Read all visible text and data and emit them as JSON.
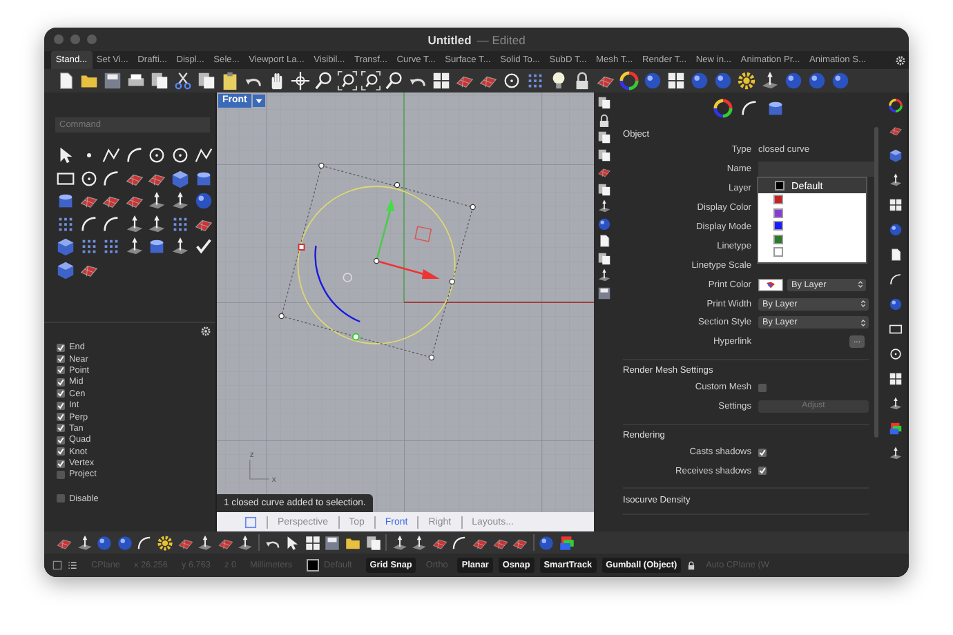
{
  "window": {
    "title": "Untitled",
    "note": "— Edited"
  },
  "toolbar_tabs": [
    {
      "label": "Stand...",
      "selected": true
    },
    {
      "label": "Set Vi...",
      "selected": false
    },
    {
      "label": "Drafti...",
      "selected": false
    },
    {
      "label": "Displ...",
      "selected": false
    },
    {
      "label": "Sele...",
      "selected": false
    },
    {
      "label": "Viewport La...",
      "selected": false
    },
    {
      "label": "Visibil...",
      "selected": false
    },
    {
      "label": "Transf...",
      "selected": false
    },
    {
      "label": "Curve T...",
      "selected": false
    },
    {
      "label": "Surface T...",
      "selected": false
    },
    {
      "label": "Solid To...",
      "selected": false
    },
    {
      "label": "SubD T...",
      "selected": false
    },
    {
      "label": "Mesh T...",
      "selected": false
    },
    {
      "label": "Render T...",
      "selected": false
    },
    {
      "label": "New in...",
      "selected": false
    },
    {
      "label": "Animation Pr...",
      "selected": false
    },
    {
      "label": "Animation S...",
      "selected": false
    }
  ],
  "command": {
    "placeholder": "Command"
  },
  "osnaps": [
    {
      "label": "End",
      "checked": true
    },
    {
      "label": "Near",
      "checked": true
    },
    {
      "label": "Point",
      "checked": true
    },
    {
      "label": "Mid",
      "checked": true
    },
    {
      "label": "Cen",
      "checked": true
    },
    {
      "label": "Int",
      "checked": true
    },
    {
      "label": "Perp",
      "checked": true
    },
    {
      "label": "Tan",
      "checked": true
    },
    {
      "label": "Quad",
      "checked": true
    },
    {
      "label": "Knot",
      "checked": true
    },
    {
      "label": "Vertex",
      "checked": true
    },
    {
      "label": "Project",
      "checked": false
    }
  ],
  "osnap_disable": {
    "label": "Disable",
    "checked": false
  },
  "viewport": {
    "name": "Front",
    "message": "1 closed curve added to selection.",
    "axis_labels": [
      "z",
      "x"
    ]
  },
  "viewport_tabs": [
    {
      "label": "Perspective",
      "selected": false
    },
    {
      "label": "Top",
      "selected": false
    },
    {
      "label": "Front",
      "selected": true
    },
    {
      "label": "Right",
      "selected": false
    },
    {
      "label": "Layouts...",
      "selected": false
    }
  ],
  "properties": {
    "sections": [
      {
        "title": "Object",
        "rows": [
          {
            "kind": "text",
            "label": "Type",
            "value": "closed curve"
          },
          {
            "kind": "field",
            "label": "Name"
          },
          {
            "kind": "covered",
            "label": "Layer"
          },
          {
            "kind": "covered",
            "label": "Display Color"
          },
          {
            "kind": "covered",
            "label": "Display Mode"
          },
          {
            "kind": "covered",
            "label": "Linetype"
          },
          {
            "kind": "covered",
            "label": "Linetype Scale"
          },
          {
            "kind": "color_select",
            "label": "Print Color",
            "value": "By Layer"
          },
          {
            "kind": "select",
            "label": "Print Width",
            "value": "By Layer"
          },
          {
            "kind": "select",
            "label": "Section Style",
            "value": "By Layer"
          },
          {
            "kind": "button",
            "label": "Hyperlink",
            "value": "...",
            "disabled": false
          }
        ]
      },
      {
        "title": "Render Mesh Settings",
        "rows": [
          {
            "kind": "checkbox",
            "label": "Custom Mesh",
            "checked": false
          },
          {
            "kind": "button",
            "label": "Settings",
            "value": "Adjust",
            "disabled": true
          }
        ]
      },
      {
        "title": "Rendering",
        "rows": [
          {
            "kind": "checkbox",
            "label": "Casts shadows",
            "checked": true
          },
          {
            "kind": "checkbox",
            "label": "Receives shadows",
            "checked": true
          }
        ]
      },
      {
        "title": "Isocurve Density"
      }
    ],
    "layer_menu": [
      {
        "label": "Default",
        "color": "#000000",
        "selected": true
      },
      {
        "color": "#cc2020",
        "selected": false
      },
      {
        "color": "#8a3ad8",
        "selected": false
      },
      {
        "color": "#1a1aff",
        "selected": false
      },
      {
        "color": "#2a7a2a",
        "selected": false
      },
      {
        "color": "#ffffff",
        "selected": false
      }
    ]
  },
  "status_bar": {
    "cplane": "CPlane",
    "x": "x 26.256",
    "y": "y 6.763",
    "z": "z 0",
    "units": "Millimeters",
    "layer": "Default",
    "toggles": [
      {
        "label": "Grid Snap",
        "on": true
      },
      {
        "label": "Ortho",
        "on": false
      },
      {
        "label": "Planar",
        "on": true
      },
      {
        "label": "Osnap",
        "on": true
      },
      {
        "label": "SmartTrack",
        "on": true
      },
      {
        "label": "Gumball (Object)",
        "on": true
      }
    ],
    "auto_cplane": {
      "label": "Auto CPlane (W",
      "on": false
    }
  }
}
